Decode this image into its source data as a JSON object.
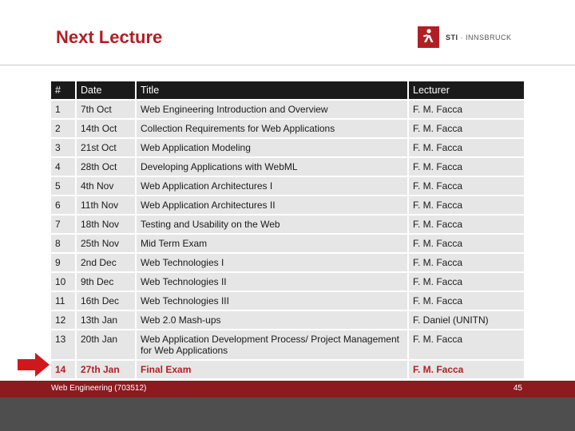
{
  "slide": {
    "title": "Next Lecture",
    "logo_text_main": "STI",
    "logo_text_rest": " · INNSBRUCK"
  },
  "table": {
    "headers": [
      "#",
      "Date",
      "Title",
      "Lecturer"
    ],
    "rows": [
      [
        "1",
        "7th Oct",
        "Web Engineering Introduction and Overview",
        "F. M. Facca"
      ],
      [
        "2",
        "14th Oct",
        "Collection Requirements for Web Applications",
        "F. M. Facca"
      ],
      [
        "3",
        "21st Oct",
        "Web Application Modeling",
        "F. M. Facca"
      ],
      [
        "4",
        "28th Oct",
        "Developing Applications with WebML",
        "F. M. Facca"
      ],
      [
        "5",
        "4th Nov",
        "Web Application Architectures I",
        "F. M. Facca"
      ],
      [
        "6",
        "11th Nov",
        "Web Application Architectures II",
        "F. M. Facca"
      ],
      [
        "7",
        "18th Nov",
        "Testing and Usability on the Web",
        "F. M. Facca"
      ],
      [
        "8",
        "25th Nov",
        "Mid Term Exam",
        "F. M. Facca"
      ],
      [
        "9",
        "2nd Dec",
        "Web Technologies I",
        "F. M. Facca"
      ],
      [
        "10",
        "9th Dec",
        "Web Technologies II",
        "F. M. Facca"
      ],
      [
        "11",
        "16th Dec",
        "Web Technologies III",
        "F. M. Facca"
      ],
      [
        "12",
        "13th Jan",
        "Web 2.0 Mash-ups",
        "F. Daniel (UNITN)"
      ],
      [
        "13",
        "20th Jan",
        "Web Application Development Process/ Project Management for Web Applications",
        "F. M. Facca"
      ],
      [
        "14",
        "27th Jan",
        "Final Exam",
        "F. M. Facca"
      ]
    ],
    "highlight_row": 14
  },
  "footer": {
    "course": "Web Engineering (703512)",
    "page": "45"
  },
  "colors": {
    "accent": "#b11f24",
    "footer": "#8c1a1e",
    "header_row": "#1a1a1a",
    "row_bg": "#e6e6e6",
    "bottom_band": "#4e4e4e"
  },
  "icons": {
    "logo": "sti-logo-icon",
    "pointer": "arrow-right-icon"
  }
}
